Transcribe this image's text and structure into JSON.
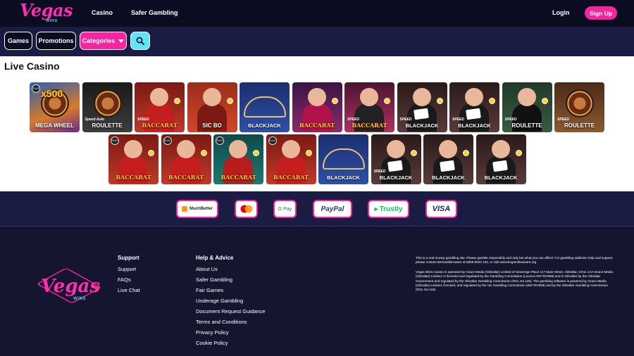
{
  "header": {
    "logo_text": "Vegas",
    "logo_sub": "WINS",
    "nav": [
      "Casino",
      "Safer Gambling"
    ],
    "login": "Login",
    "signup": "Sign Up"
  },
  "filters": {
    "games": "Games",
    "promotions": "Promotions",
    "categories": "Categories"
  },
  "main": {
    "title": "Live Casino",
    "row1": [
      {
        "label": "MEGA WHEEL",
        "sub": "",
        "style": "megawheel"
      },
      {
        "label": "ROULETTE",
        "sub": "Speed Auto",
        "style": "roulette-dark"
      },
      {
        "label": "BACCARAT",
        "sub": "SPEED",
        "style": "baccarat-red"
      },
      {
        "label": "SIC BO",
        "sub": "",
        "style": "sicbo"
      },
      {
        "label": "BLACKJACK",
        "sub": "",
        "style": "blackjack-blue"
      },
      {
        "label": "BACCARAT",
        "sub": "",
        "style": "baccarat-purple"
      },
      {
        "label": "BACCARAT",
        "sub": "SPEED",
        "style": "baccarat-pink"
      },
      {
        "label": "BLACKJACK",
        "sub": "SPEED",
        "style": "blackjack-dark"
      },
      {
        "label": "BLACKJACK",
        "sub": "SPEED",
        "style": "blackjack-dark"
      },
      {
        "label": "ROULETTE",
        "sub": "SPEED",
        "style": "roulette-man"
      },
      {
        "label": "ROULETTE",
        "sub": "SPEED",
        "style": "roulette-brown"
      }
    ],
    "row2": [
      {
        "label": "BACCARAT",
        "sub": "",
        "style": "baccarat-red"
      },
      {
        "label": "BACCARAT",
        "sub": "",
        "style": "baccarat-red"
      },
      {
        "label": "BACCARAT",
        "sub": "",
        "style": "baccarat-teal"
      },
      {
        "label": "BACCARAT",
        "sub": "",
        "style": "baccarat-red"
      },
      {
        "label": "BLACKJACK",
        "sub": "",
        "style": "blackjack-blue"
      },
      {
        "label": "BLACKJACK",
        "sub": "SPEED",
        "style": "blackjack-dark"
      },
      {
        "label": "BLACKJACK",
        "sub": "",
        "style": "blackjack-dark"
      },
      {
        "label": "BLACKJACK",
        "sub": "",
        "style": "blackjack-dark"
      }
    ],
    "megawheel_x": "x500",
    "play_badge": "PLAY"
  },
  "payments": [
    "MuchBetter",
    "mastercard",
    "G Pay",
    "PayPal",
    "Trustly",
    "VISA"
  ],
  "footer": {
    "logo_text": "Vegas",
    "logo_sub": "WINS",
    "support": {
      "title": "Support",
      "links": [
        "Support",
        "FAQs",
        "Live Chat"
      ]
    },
    "help": {
      "title": "Help & Advice",
      "links": [
        "About Us",
        "Safer Gambling",
        "Fair Games",
        "Underage Gambling",
        "Document Request Guidance",
        "Terms and Conditions",
        "Privacy Policy",
        "Cookie Policy"
      ]
    },
    "legal1": "This is a real-money gambling site. Please gamble responsibly and only bet what you can afford. For gambling addiction help and support, please contact BeGambleAware at 0808 8020 133, or visit www.begambleaware.org",
    "legal2": "Vegas Wins Casino is operated by Grace Media (Gibraltar) Limited of Sovereign Place 117 Main Street, Gibraltar, GX11 1AA Grace Media (Gibraltar) Limited, is licensed and regulated by the Gambling Commission (Licence Ref #57869) and in Gibraltar by the Gibraltar Government and regulated by the Gibraltar Gambling Commission (RGL No.125). The gambling software is powered by Grace Media (Gibraltar) Limited, licensed, and regulated by the UK Gambling Commission (Ref #57869) and by the Gibraltar Gambling Commission (RGL No.118)."
  },
  "colors": {
    "accent": "#f7249f",
    "cyan": "#62e2f7",
    "dark": "#0b0b22",
    "bar": "#1b1c44"
  }
}
